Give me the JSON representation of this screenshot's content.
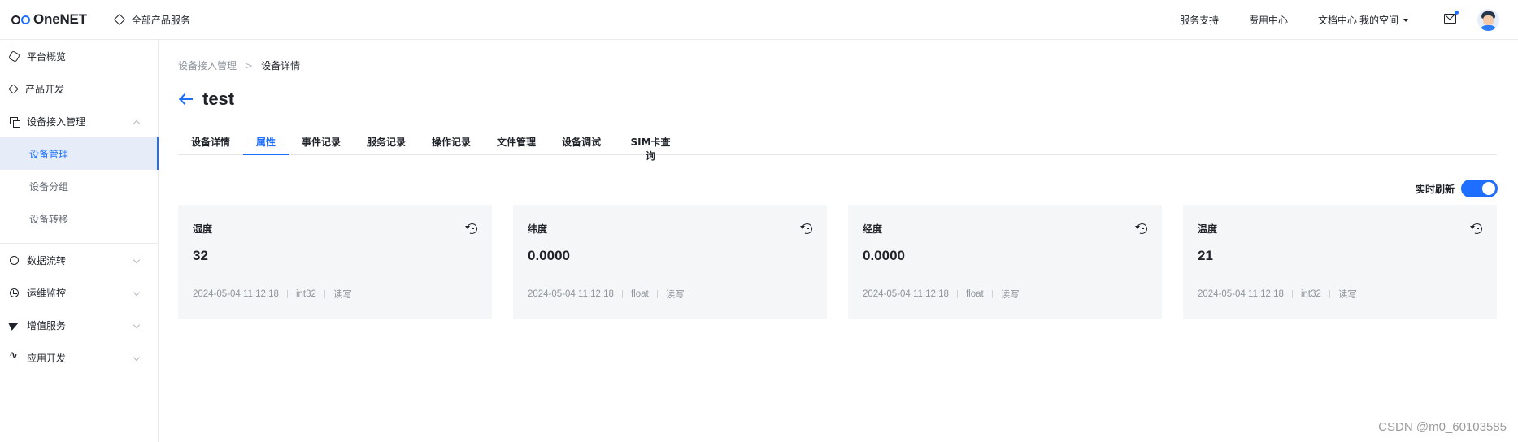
{
  "header": {
    "logo_text": "OneNET",
    "all_products": "全部产品服务",
    "nav": [
      "服务支持",
      "费用中心",
      "文档中心",
      "我的空间"
    ]
  },
  "sidebar": {
    "items": [
      {
        "label": "平台概览",
        "icon": "hexagon-icon"
      },
      {
        "label": "产品开发",
        "icon": "cube-icon"
      },
      {
        "label": "设备接入管理",
        "icon": "device-icon",
        "expanded": true
      },
      {
        "label": "数据流转",
        "icon": "data-flow-icon"
      },
      {
        "label": "运维监控",
        "icon": "monitor-icon"
      },
      {
        "label": "增值服务",
        "icon": "send-icon"
      },
      {
        "label": "应用开发",
        "icon": "app-dev-icon"
      }
    ],
    "subitems": [
      {
        "label": "设备管理",
        "active": true
      },
      {
        "label": "设备分组",
        "active": false
      },
      {
        "label": "设备转移",
        "active": false
      }
    ]
  },
  "breadcrumb": {
    "parent": "设备接入管理",
    "separator": ">",
    "current": "设备详情"
  },
  "page_title": "test",
  "tabs": {
    "items": [
      "设备详情",
      "属性",
      "事件记录",
      "服务记录",
      "操作记录",
      "文件管理",
      "设备调试",
      "SIM卡查询"
    ],
    "active_index": 1
  },
  "realtime": {
    "label": "实时刷新",
    "enabled": true
  },
  "properties": [
    {
      "name": "湿度",
      "value": "32",
      "time": "2024-05-04 11:12:18",
      "type": "int32",
      "access": "读写"
    },
    {
      "name": "纬度",
      "value": "0.0000",
      "time": "2024-05-04 11:12:18",
      "type": "float",
      "access": "读写"
    },
    {
      "name": "经度",
      "value": "0.0000",
      "time": "2024-05-04 11:12:18",
      "type": "float",
      "access": "读写"
    },
    {
      "name": "温度",
      "value": "21",
      "time": "2024-05-04 11:12:18",
      "type": "int32",
      "access": "读写"
    }
  ],
  "watermark": "CSDN @m0_60103585",
  "colors": {
    "accent": "#1e6fff",
    "active_bg": "#e6edf9",
    "card_bg": "#f5f6f8",
    "text_muted": "#8f959e"
  }
}
